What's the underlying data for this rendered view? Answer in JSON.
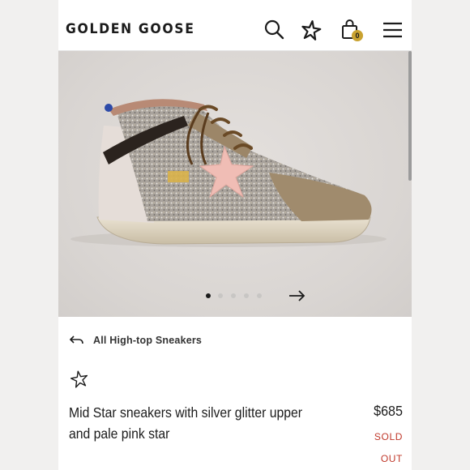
{
  "header": {
    "brand": "GOLDEN GOOSE",
    "search_icon": "search-icon",
    "wishlist_icon": "star-outline-icon",
    "cart_icon": "shopping-bag-icon",
    "cart_count": "0",
    "menu_icon": "hamburger-menu-icon",
    "cart_badge_color": "#c9a230"
  },
  "gallery": {
    "image_count": 5,
    "active_index": 0,
    "next_icon": "arrow-right-icon"
  },
  "breadcrumb": {
    "back_icon": "back-arrow-icon",
    "label": "All High-top Sneakers"
  },
  "product": {
    "wishlist_icon": "star-outline-icon",
    "title": "Mid Star sneakers with silver glitter upper and pale pink star",
    "price": "$685",
    "status": "SOLD OUT",
    "status_color": "#c0392b"
  }
}
